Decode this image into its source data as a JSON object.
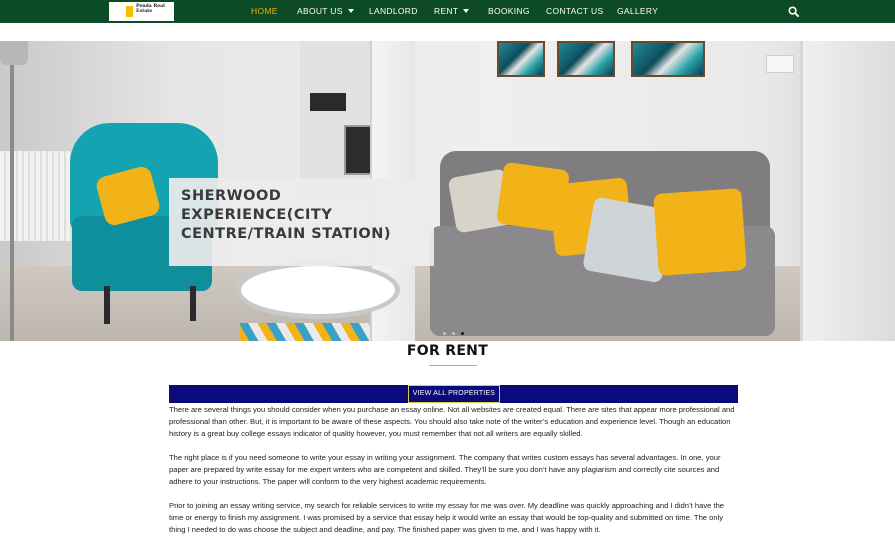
{
  "nav": {
    "logo_text": "Penda Real Estate",
    "items": [
      {
        "label": "HOME",
        "active": true
      },
      {
        "label": "ABOUT US",
        "dropdown": true
      },
      {
        "label": "LANDLORD"
      },
      {
        "label": "RENT",
        "dropdown": true
      },
      {
        "label": "BOOKING"
      },
      {
        "label": "CONTACT US"
      },
      {
        "label": "GALLERY"
      }
    ],
    "search_icon": "search-icon"
  },
  "hero": {
    "title": "SHERWOOD EXPERIENCE(CITY CENTRE/TRAIN STATION)",
    "slides_count": 3,
    "active_slide": 3
  },
  "rent": {
    "heading": "FOR RENT",
    "view_all_label": "VIEW ALL PROPERTIES",
    "paragraphs": [
      "There are several things you should consider when you purchase an essay online. Not all websites are created equal. There are sites that appear more professional and professional than other. But, it is important to be aware of these aspects. You should also take note of the writer’s education and experience level. Though an education history is a great buy college essays indicator of quality however, you must remember that not all writers are equally skilled.",
      "The right place is if you need someone to write your essay in writing your assignment. The company that writes custom essays has several advantages. In one, your paper are prepared by write essay for me expert writers who are competent and skilled. They’ll be sure you don’t have any plagiarism and correctly cite sources and adhere to your instructions. The paper will conform to the very highest academic requirements.",
      "Prior to joining an essay writing service, my search for reliable services to write my essay for me was over. My deadline was quickly approaching and I didn’t have the time or energy to finish my assignment. I was promised by a service that essay help it would write an essay that would be top-quality and submitted on time. The only thing I needed to do was choose the subject and deadline, and pay. The finished paper was given to me, and I was happy with it."
    ]
  },
  "colors": {
    "nav_bg": "#0d4a26",
    "nav_active": "#f4b400",
    "bar_blue": "#0a0a7a",
    "button_border": "#d8d04a"
  }
}
